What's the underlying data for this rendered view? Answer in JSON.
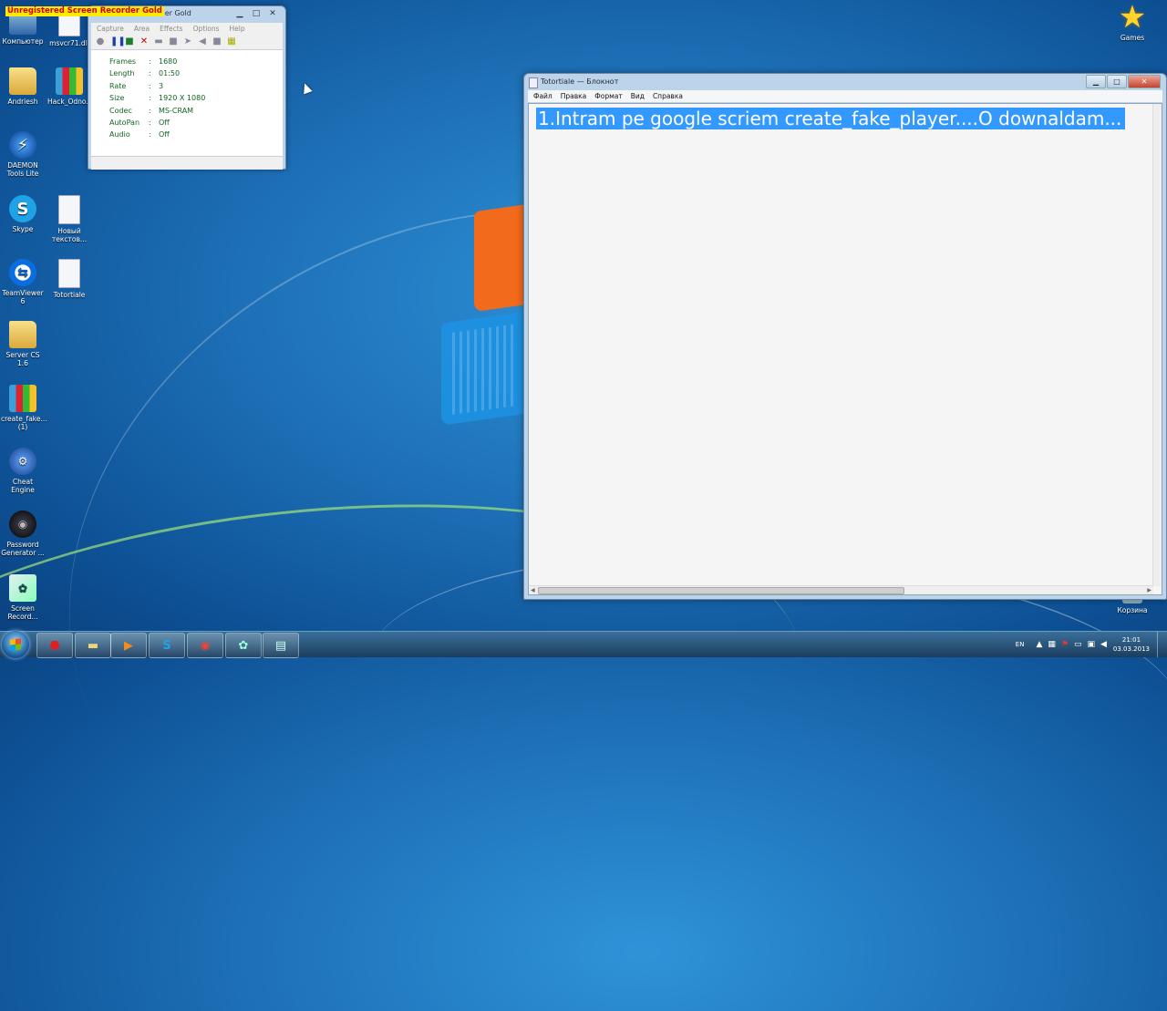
{
  "desktop": {
    "icons": [
      {
        "label": "Компьютер",
        "icon": "computer-icon"
      },
      {
        "label": "msvcr71.dll",
        "icon": "dll-file-icon"
      },
      {
        "label": "Andriesh",
        "icon": "folder-icon"
      },
      {
        "label": "Hack_Odno...",
        "icon": "winrar-archive-icon"
      },
      {
        "label": "DAEMON Tools Lite",
        "icon": "daemon-tools-icon"
      },
      {
        "label": "Skype",
        "icon": "skype-icon"
      },
      {
        "label": "Новый текстов...",
        "icon": "text-file-icon"
      },
      {
        "label": "TeamViewer 6",
        "icon": "teamviewer-icon"
      },
      {
        "label": "Totortiale",
        "icon": "text-file-icon"
      },
      {
        "label": "Server CS 1.6",
        "icon": "folder-icon"
      },
      {
        "label": "create_fake... (1)",
        "icon": "winrar-archive-icon"
      },
      {
        "label": "Cheat Engine",
        "icon": "cheat-engine-icon"
      },
      {
        "label": "Password Generator ...",
        "icon": "password-generator-icon"
      },
      {
        "label": "Screen Record...",
        "icon": "screen-recorder-icon"
      },
      {
        "label": "Games",
        "icon": "games-star-icon"
      },
      {
        "label": "Корзина",
        "icon": "recycle-bin-icon"
      }
    ]
  },
  "recorder": {
    "watermark": "Unregistered Screen Recorder Gold",
    "title": "Screen Recorder Gold",
    "menu": [
      "Capture",
      "Area",
      "Effects",
      "Options",
      "Help"
    ],
    "info": [
      {
        "key": "Frames",
        "value": "1680"
      },
      {
        "key": "Length",
        "value": "01:50"
      },
      {
        "key": "Rate",
        "value": "3"
      },
      {
        "key": "Size",
        "value": "1920 X 1080"
      },
      {
        "key": "Codec",
        "value": "MS-CRAM"
      },
      {
        "key": "AutoPan",
        "value": "Off"
      },
      {
        "key": "Audio",
        "value": "Off"
      }
    ]
  },
  "notepad": {
    "title": "Totortiale — Блокнот",
    "menu": [
      "Файл",
      "Правка",
      "Формат",
      "Вид",
      "Справка"
    ],
    "content": "1.Intram pe google scriem create_fake_player....O downaldam..."
  },
  "taskbar": {
    "apps": [
      "adobe-reader-icon",
      "explorer-folder-icon",
      "media-player-icon",
      "skype-icon",
      "chrome-icon",
      "screen-recorder-icon",
      "notepad-icon"
    ],
    "language": "EN",
    "time": "21:01",
    "date": "03.03.2013"
  },
  "colors": {
    "selection": "#3399ff",
    "watermark_bg": "#ffeb00",
    "watermark_text": "#cc0000"
  }
}
